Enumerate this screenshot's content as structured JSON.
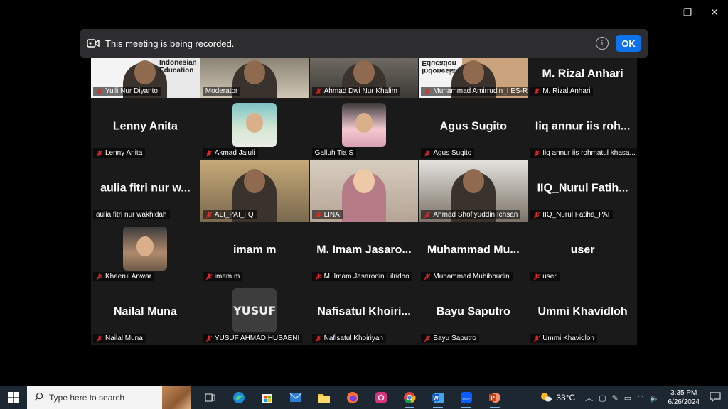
{
  "window_controls": {
    "minimize": "—",
    "restore": "❐",
    "close": "✕"
  },
  "banner": {
    "text": "This meeting is being recorded.",
    "ok_label": "OK"
  },
  "tiles": [
    {
      "name": "Yulli Nur Diyanto",
      "big": "",
      "type": "video",
      "speaking": true
    },
    {
      "name": "Moderator",
      "big": "",
      "type": "video"
    },
    {
      "name": "Ahmad Dwi Nur Khalim",
      "big": "",
      "type": "video"
    },
    {
      "name": "Muhammad Amirrudin_I ES-R",
      "big": "",
      "type": "video"
    },
    {
      "name": "M. Rizal Anhari",
      "big": "M. Rizal Anhari",
      "type": "name"
    },
    {
      "name": "Lenny Anita",
      "big": "Lenny Anita",
      "type": "name"
    },
    {
      "name": "Akmad Jajuli",
      "big": "",
      "type": "avatar"
    },
    {
      "name": "Galluh Tia S",
      "big": "",
      "type": "avatar"
    },
    {
      "name": "Agus Sugito",
      "big": "Agus Sugito",
      "type": "name"
    },
    {
      "name": "Iiq annur iis rohmatul khasa...",
      "big": "Iiq annur iis roh...",
      "type": "name"
    },
    {
      "name": "aulia fitri nur wakhidah",
      "big": "aulia fitri nur w...",
      "type": "name"
    },
    {
      "name": "ALI_PAI_IIQ",
      "big": "",
      "type": "video"
    },
    {
      "name": "LINA",
      "big": "",
      "type": "video"
    },
    {
      "name": "Ahmad Shofiyuddin Ichsan",
      "big": "",
      "type": "video"
    },
    {
      "name": "IIQ_Nurul Fatiha_PAI",
      "big": "IIQ_Nurul  Fatih...",
      "type": "name"
    },
    {
      "name": "Khaerul Anwar",
      "big": "",
      "type": "avatar"
    },
    {
      "name": "imam m",
      "big": "imam m",
      "type": "name"
    },
    {
      "name": "M. Imam Jasarodin Lilridho",
      "big": "M.  Imam  Jasaro...",
      "type": "name"
    },
    {
      "name": "Muhammad Muhibbudin",
      "big": "Muhammad  Mu...",
      "type": "name"
    },
    {
      "name": "user",
      "big": "user",
      "type": "name"
    },
    {
      "name": "Nailal Muna",
      "big": "Nailal Muna",
      "type": "name"
    },
    {
      "name": "YUSUF AHMAD HUSAENI",
      "big": "",
      "type": "avatar",
      "avatar_text": "YUSUF"
    },
    {
      "name": "Nafisatul Khoiriyah",
      "big": "Nafisatul  Khoiri...",
      "type": "name"
    },
    {
      "name": "Bayu Saputro",
      "big": "Bayu Saputro",
      "type": "name"
    },
    {
      "name": "Ummi Khavidloh",
      "big": "Ummi Khavidloh",
      "type": "name"
    }
  ],
  "video_texts": {
    "indonesian": "Indonesian",
    "education": "Education"
  },
  "taskbar": {
    "search_placeholder": "Type here to search",
    "temperature": "33°C",
    "time": "3:35 PM",
    "date": "6/26/2024"
  },
  "colors": {
    "accent": "#0e72ed",
    "speaking": "#23d959",
    "muted": "#e02828"
  }
}
